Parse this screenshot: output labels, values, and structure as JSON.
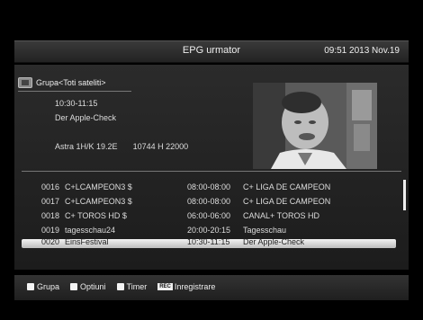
{
  "header": {
    "title": "EPG urmator",
    "clock": "09:51 2013 Nov.19"
  },
  "info": {
    "group_icon": "tv-icon",
    "group_label": "Grupa<Toti sateliti>",
    "time": "10:30-11:15",
    "program": "Der Apple-Check",
    "satellite": "Astra 1H/K 19.2E",
    "transponder": "10744 H 22000"
  },
  "list": {
    "rows": [
      {
        "num": "0016",
        "channel": "C+LCAMPEON3 $",
        "time": "08:00-08:00",
        "event": "C+ LIGA DE CAMPEON"
      },
      {
        "num": "0017",
        "channel": "C+LCAMPEON3 $",
        "time": "08:00-08:00",
        "event": "C+ LIGA DE CAMPEON"
      },
      {
        "num": "0018",
        "channel": "C+ TOROS HD  $",
        "time": "06:00-06:00",
        "event": "CANAL+ TOROS HD"
      },
      {
        "num": "0019",
        "channel": "tagesschau24",
        "time": "20:00-20:15",
        "event": "Tagesschau"
      },
      {
        "num": "0020",
        "channel": "EinsFestival",
        "time": "10:30-11:15",
        "event": "Der Apple-Check"
      }
    ]
  },
  "footer": {
    "keys": [
      {
        "label": "Grupa"
      },
      {
        "label": "Optiuni"
      },
      {
        "label": "Timer"
      },
      {
        "label": "Inregistrare",
        "badge": "REC"
      }
    ]
  }
}
